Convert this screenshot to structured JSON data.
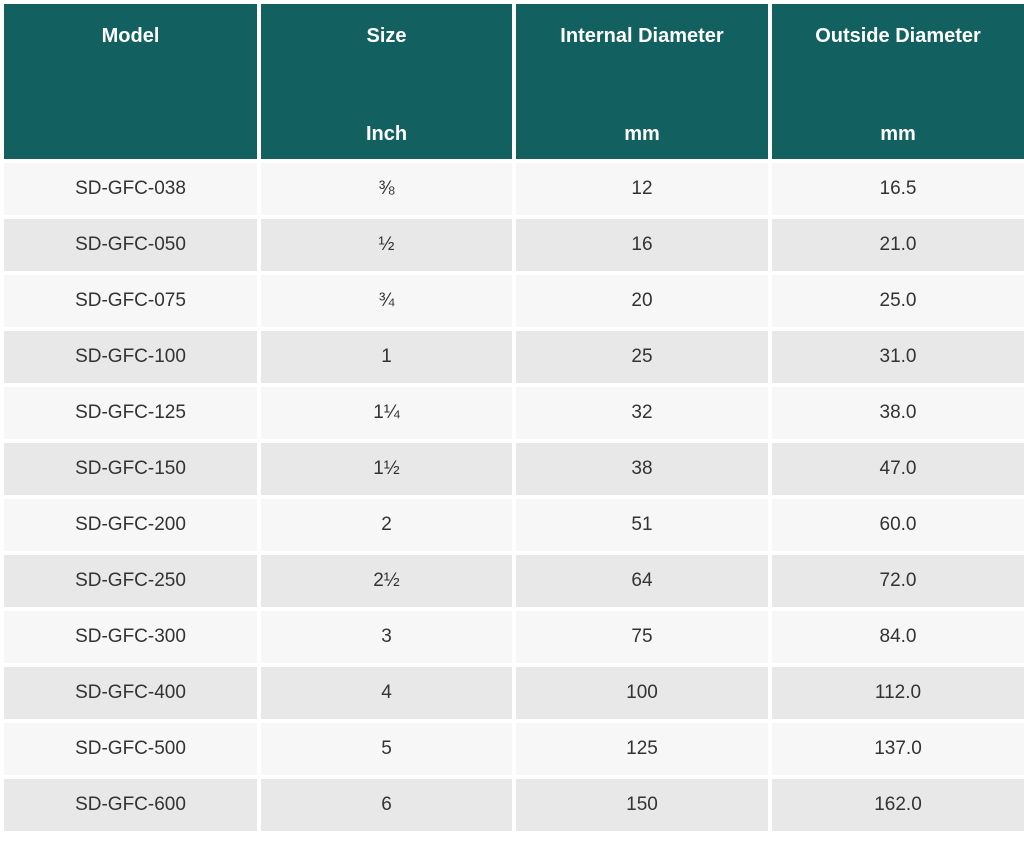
{
  "table": {
    "headers": [
      {
        "label": "Model",
        "unit": ""
      },
      {
        "label": "Size",
        "unit": "Inch"
      },
      {
        "label": "Internal Diameter",
        "unit": "mm"
      },
      {
        "label": "Outside Diameter",
        "unit": "mm"
      }
    ],
    "rows": [
      [
        "SD-GFC-038",
        "⅜",
        "12",
        "16.5"
      ],
      [
        "SD-GFC-050",
        "½",
        "16",
        "21.0"
      ],
      [
        "SD-GFC-075",
        "¾",
        "20",
        "25.0"
      ],
      [
        "SD-GFC-100",
        "1",
        "25",
        "31.0"
      ],
      [
        "SD-GFC-125",
        "1¼",
        "32",
        "38.0"
      ],
      [
        "SD-GFC-150",
        "1½",
        "38",
        "47.0"
      ],
      [
        "SD-GFC-200",
        "2",
        "51",
        "60.0"
      ],
      [
        "SD-GFC-250",
        "2½",
        "64",
        "72.0"
      ],
      [
        "SD-GFC-300",
        "3",
        "75",
        "84.0"
      ],
      [
        "SD-GFC-400",
        "4",
        "100",
        "112.0"
      ],
      [
        "SD-GFC-500",
        "5",
        "125",
        "137.0"
      ],
      [
        "SD-GFC-600",
        "6",
        "150",
        "162.0"
      ]
    ]
  },
  "colors": {
    "header_bg": "#136060",
    "header_text": "#ffffff",
    "row_light": "#f7f7f7",
    "row_dark": "#e8e8e8",
    "cell_text": "#333333"
  }
}
